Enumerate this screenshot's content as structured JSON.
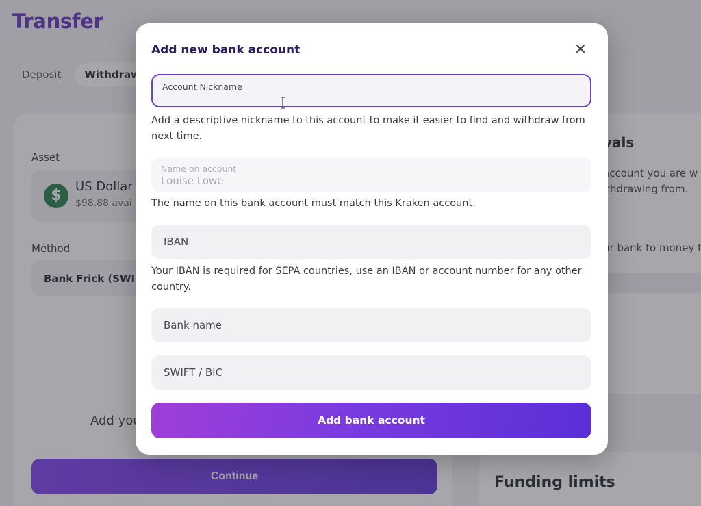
{
  "background": {
    "page_title": "Transfer",
    "tabs": [
      {
        "label": "Deposit"
      },
      {
        "label": "Withdraw"
      }
    ],
    "asset_label": "Asset",
    "asset": {
      "icon": "$",
      "name": "US Dollar",
      "balance": "$98.88 avai"
    },
    "method_label": "Method",
    "method_value": "Bank Frick (SWIFT",
    "add_text": "Add you",
    "continue_label": "Continue",
    "right_panel": {
      "title": "vals",
      "line1": "account you are w",
      "line2": "ithdrawing from.",
      "line3": "ur bank to money t"
    },
    "funding_title": "Funding limits"
  },
  "modal": {
    "title": "Add new bank account",
    "close_icon": "close-icon",
    "account_nickname": {
      "label": "Account Nickname",
      "value": "",
      "helper": "Add a descriptive nickname to this account to make it easier to find and withdraw from next time."
    },
    "name_on_account": {
      "label": "Name on account",
      "value": "Louise Lowe",
      "helper": "The name on this bank account must match this Kraken account."
    },
    "iban": {
      "placeholder": "IBAN",
      "helper": "Your IBAN is required for SEPA countries, use an IBAN or account number for any other country."
    },
    "bank_name": {
      "placeholder": "Bank name"
    },
    "swift_bic": {
      "placeholder": "SWIFT / BIC"
    },
    "submit_label": "Add bank account"
  },
  "colors": {
    "accent": "#6a3fd4",
    "title": "#5b2fbd",
    "button_start": "#a03ed8",
    "button_end": "#5a2fd6"
  }
}
